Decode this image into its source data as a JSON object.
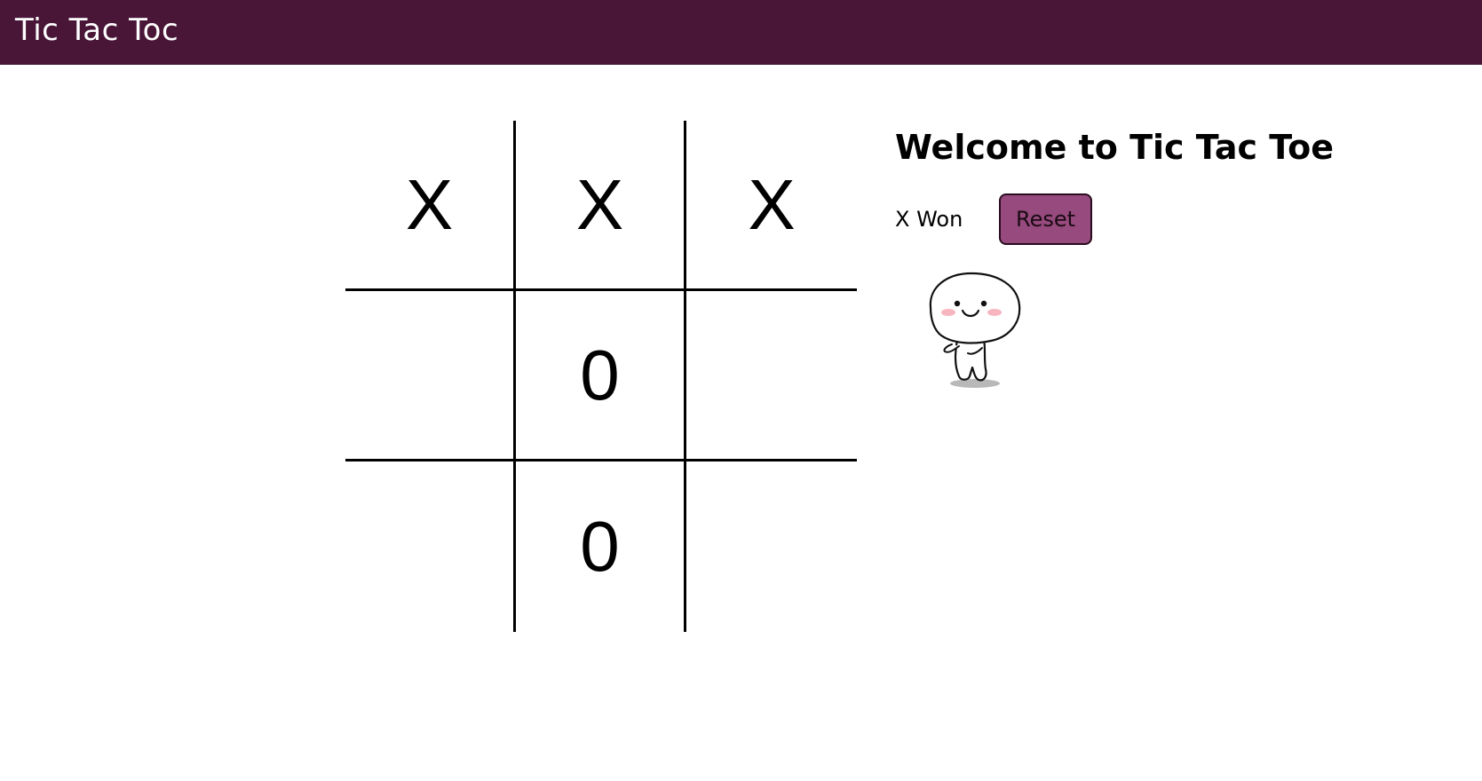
{
  "navbar": {
    "title": "Tic Tac Toc",
    "background_color": "#491638"
  },
  "board": {
    "cells": [
      "X",
      "X",
      "X",
      "",
      "0",
      "",
      "",
      "0",
      ""
    ]
  },
  "info": {
    "heading": "Welcome to Tic Tac Toe",
    "status": "X Won",
    "reset_label": "Reset",
    "reset_color": "#964a7d"
  },
  "mascot": {
    "icon": "smiling-cartoon-character-icon"
  }
}
